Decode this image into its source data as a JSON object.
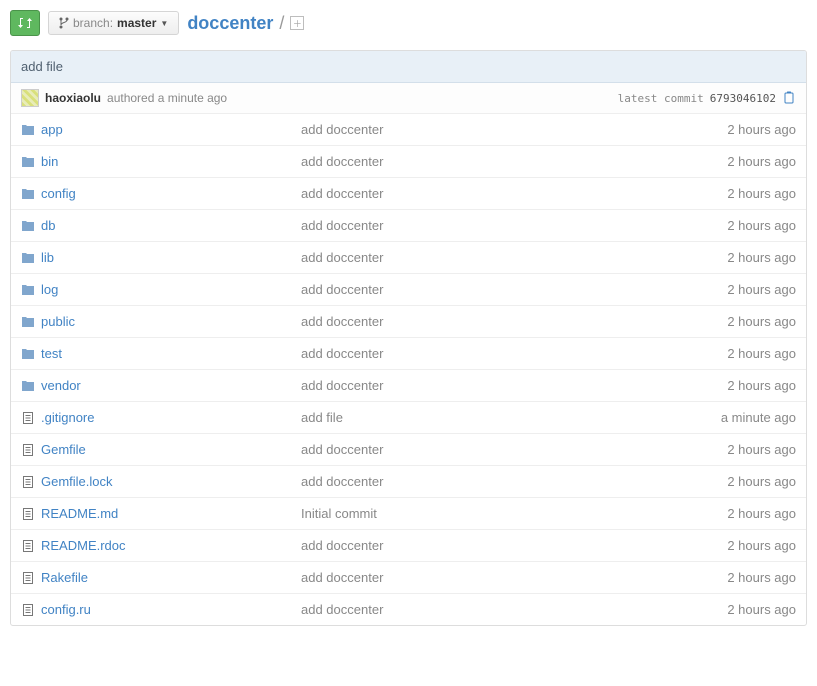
{
  "header": {
    "branch_label": "branch:",
    "branch_name": "master",
    "repo_name": "doccenter",
    "slash": "/"
  },
  "commit": {
    "message": "add file",
    "author": "haoxiaolu",
    "authored_text": "authored a minute ago",
    "latest_label": "latest commit",
    "sha": "6793046102"
  },
  "rows": [
    {
      "type": "dir",
      "name": "app",
      "msg": "add doccenter",
      "time": "2 hours ago"
    },
    {
      "type": "dir",
      "name": "bin",
      "msg": "add doccenter",
      "time": "2 hours ago"
    },
    {
      "type": "dir",
      "name": "config",
      "msg": "add doccenter",
      "time": "2 hours ago"
    },
    {
      "type": "dir",
      "name": "db",
      "msg": "add doccenter",
      "time": "2 hours ago"
    },
    {
      "type": "dir",
      "name": "lib",
      "msg": "add doccenter",
      "time": "2 hours ago"
    },
    {
      "type": "dir",
      "name": "log",
      "msg": "add doccenter",
      "time": "2 hours ago"
    },
    {
      "type": "dir",
      "name": "public",
      "msg": "add doccenter",
      "time": "2 hours ago"
    },
    {
      "type": "dir",
      "name": "test",
      "msg": "add doccenter",
      "time": "2 hours ago"
    },
    {
      "type": "dir",
      "name": "vendor",
      "msg": "add doccenter",
      "time": "2 hours ago"
    },
    {
      "type": "file",
      "name": ".gitignore",
      "msg": "add file",
      "time": "a minute ago"
    },
    {
      "type": "file",
      "name": "Gemfile",
      "msg": "add doccenter",
      "time": "2 hours ago"
    },
    {
      "type": "file",
      "name": "Gemfile.lock",
      "msg": "add doccenter",
      "time": "2 hours ago"
    },
    {
      "type": "file",
      "name": "README.md",
      "msg": "Initial commit",
      "time": "2 hours ago"
    },
    {
      "type": "file",
      "name": "README.rdoc",
      "msg": "add doccenter",
      "time": "2 hours ago"
    },
    {
      "type": "file",
      "name": "Rakefile",
      "msg": "add doccenter",
      "time": "2 hours ago"
    },
    {
      "type": "file",
      "name": "config.ru",
      "msg": "add doccenter",
      "time": "2 hours ago"
    }
  ]
}
